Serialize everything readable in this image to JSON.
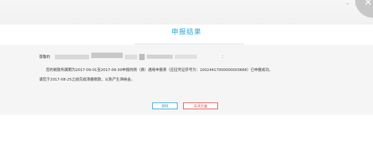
{
  "window": {
    "minimize_glyph": "–",
    "maximize_glyph": "□",
    "close_glyph": "✕"
  },
  "header": {
    "title": "申报结果"
  },
  "message": {
    "greeting_prefix": "尊敬的",
    "greeting_suffix": "：",
    "line1": "您的税款所属期为2017-09-01至2017-09-30申报的税（费）通用申报表（应征凭证序号为：10024417000000003668）已申报成功。",
    "line2": "请您于2017-08-25之前完成清缴税款，以免产生滞纳金。"
  },
  "actions": {
    "pay_label": "缴税",
    "close_label": "关闭页面"
  },
  "colors": {
    "accent": "#2aa4d8",
    "danger": "#e45454",
    "panel": "#f5f5f5"
  }
}
